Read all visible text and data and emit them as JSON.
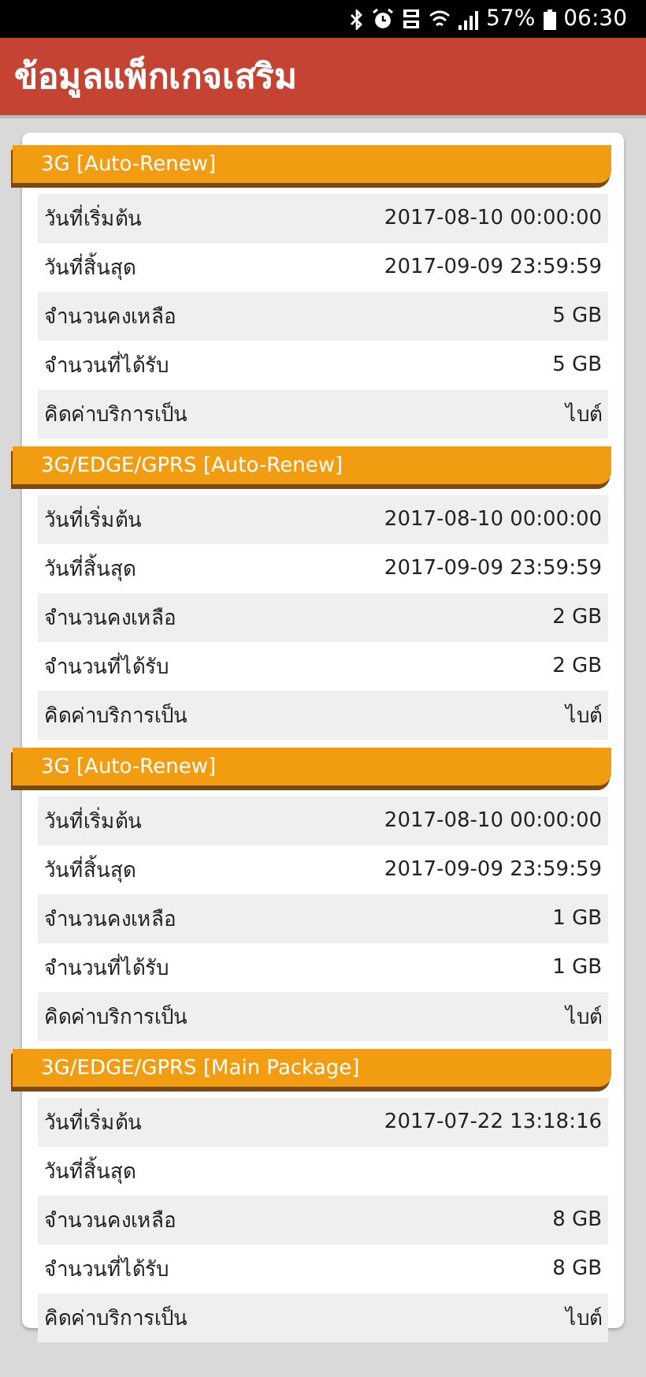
{
  "status_bar": {
    "battery_text": "57%",
    "time": "06:30"
  },
  "header": {
    "title": "ข้อมูลแพ็กเกจเสริม"
  },
  "packages": [
    {
      "title": "3G [Auto-Renew]",
      "rows": [
        {
          "label": "วันที่เริ่มต้น",
          "value": "2017-08-10 00:00:00"
        },
        {
          "label": "วันที่สิ้นสุด",
          "value": "2017-09-09 23:59:59"
        },
        {
          "label": "จำนวนคงเหลือ",
          "value": "5 GB"
        },
        {
          "label": "จำนวนที่ได้รับ",
          "value": "5 GB"
        },
        {
          "label": "คิดค่าบริการเป็น",
          "value": "ไบต์"
        }
      ]
    },
    {
      "title": "3G/EDGE/GPRS [Auto-Renew]",
      "rows": [
        {
          "label": "วันที่เริ่มต้น",
          "value": "2017-08-10 00:00:00"
        },
        {
          "label": "วันที่สิ้นสุด",
          "value": "2017-09-09 23:59:59"
        },
        {
          "label": "จำนวนคงเหลือ",
          "value": "2 GB"
        },
        {
          "label": "จำนวนที่ได้รับ",
          "value": "2 GB"
        },
        {
          "label": "คิดค่าบริการเป็น",
          "value": "ไบต์"
        }
      ]
    },
    {
      "title": "3G [Auto-Renew]",
      "rows": [
        {
          "label": "วันที่เริ่มต้น",
          "value": "2017-08-10 00:00:00"
        },
        {
          "label": "วันที่สิ้นสุด",
          "value": "2017-09-09 23:59:59"
        },
        {
          "label": "จำนวนคงเหลือ",
          "value": "1 GB"
        },
        {
          "label": "จำนวนที่ได้รับ",
          "value": "1 GB"
        },
        {
          "label": "คิดค่าบริการเป็น",
          "value": "ไบต์"
        }
      ]
    },
    {
      "title": "3G/EDGE/GPRS [Main Package]",
      "rows": [
        {
          "label": "วันที่เริ่มต้น",
          "value": "2017-07-22 13:18:16"
        },
        {
          "label": "วันที่สิ้นสุด"
        },
        {
          "label": "จำนวนคงเหลือ",
          "value": "8 GB"
        },
        {
          "label": "จำนวนที่ได้รับ",
          "value": "8 GB"
        },
        {
          "label": "คิดค่าบริการเป็น",
          "value": "ไบต์"
        }
      ]
    }
  ]
}
